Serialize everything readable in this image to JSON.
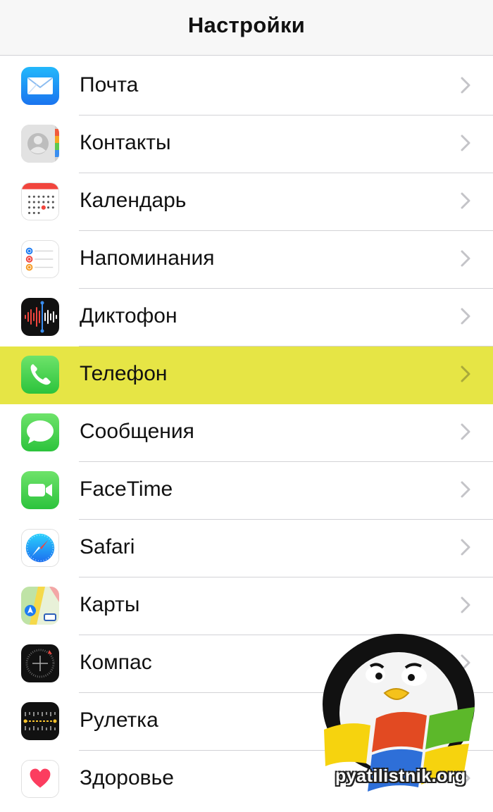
{
  "navbar": {
    "title": "Настройки"
  },
  "settings": [
    {
      "label": "Почта",
      "icon": "mail-icon",
      "highlighted": false
    },
    {
      "label": "Контакты",
      "icon": "contacts-icon",
      "highlighted": false
    },
    {
      "label": "Календарь",
      "icon": "calendar-icon",
      "highlighted": false
    },
    {
      "label": "Напоминания",
      "icon": "reminders-icon",
      "highlighted": false
    },
    {
      "label": "Диктофон",
      "icon": "voice-memos-icon",
      "highlighted": false
    },
    {
      "label": "Телефон",
      "icon": "phone-icon",
      "highlighted": true
    },
    {
      "label": "Сообщения",
      "icon": "messages-icon",
      "highlighted": false
    },
    {
      "label": "FaceTime",
      "icon": "facetime-icon",
      "highlighted": false
    },
    {
      "label": "Safari",
      "icon": "safari-icon",
      "highlighted": false
    },
    {
      "label": "Карты",
      "icon": "maps-icon",
      "highlighted": false
    },
    {
      "label": "Компас",
      "icon": "compass-icon",
      "highlighted": false
    },
    {
      "label": "Рулетка",
      "icon": "measure-icon",
      "highlighted": false
    },
    {
      "label": "Здоровье",
      "icon": "health-icon",
      "highlighted": false
    }
  ],
  "colors": {
    "highlight": "#e6e545",
    "separator": "#d2d2d6",
    "chevron": "#c4c4c8"
  },
  "watermark": {
    "text": "pyatilistnik.org"
  }
}
